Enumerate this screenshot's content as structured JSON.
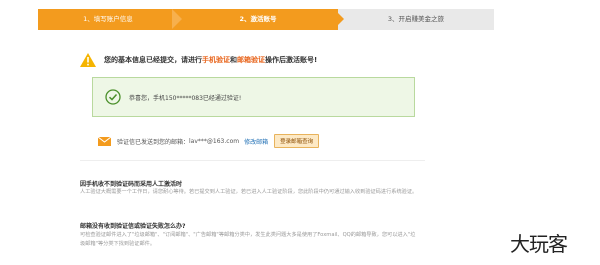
{
  "steps": [
    {
      "label": "1、填写账户信息"
    },
    {
      "label": "2、激活账号"
    },
    {
      "label": "3、开启赚美金之旅"
    }
  ],
  "notice": {
    "prefix": "您的基本信息已经提交，请进行",
    "phone_verify": "手机验证",
    "and": "和",
    "email_verify": "邮箱验证",
    "suffix": "操作后激活账号!"
  },
  "success": {
    "text": "恭喜您，手机150*****083已经通过验证!"
  },
  "email": {
    "text": "验证信已发送到您的邮箱：",
    "address": "lav***@163.com",
    "modify_link": "修改邮箱",
    "login_button": "登录邮箱查询"
  },
  "faq": [
    {
      "q": "因手机收不到验证码而采用人工激活时",
      "a": "人工验证大概需要一个工作日，请您耐心等待。若已提交到人工验证，若已进入人工验证阶段，您此阶段中仍可通过输入收到验证码进行系统验证。"
    },
    {
      "q": "邮箱没有收到验证信或验证失败怎么办?",
      "a": "可检查验证邮件进入了\"垃圾邮箱\"、\"订阅邮箱\"、\"广告邮箱\"等邮箱分类中，发生此类问题大多是使用了Foxmail、QQ的邮箱导致，您可以进入\"垃圾邮箱\"等分类下找到验证邮件。"
    }
  ],
  "watermark": "大玩客",
  "colors": {
    "accent": "#f39b1e",
    "highlight": "#e8641b",
    "success_bg": "#eef7e6",
    "link": "#1f6fb5"
  }
}
